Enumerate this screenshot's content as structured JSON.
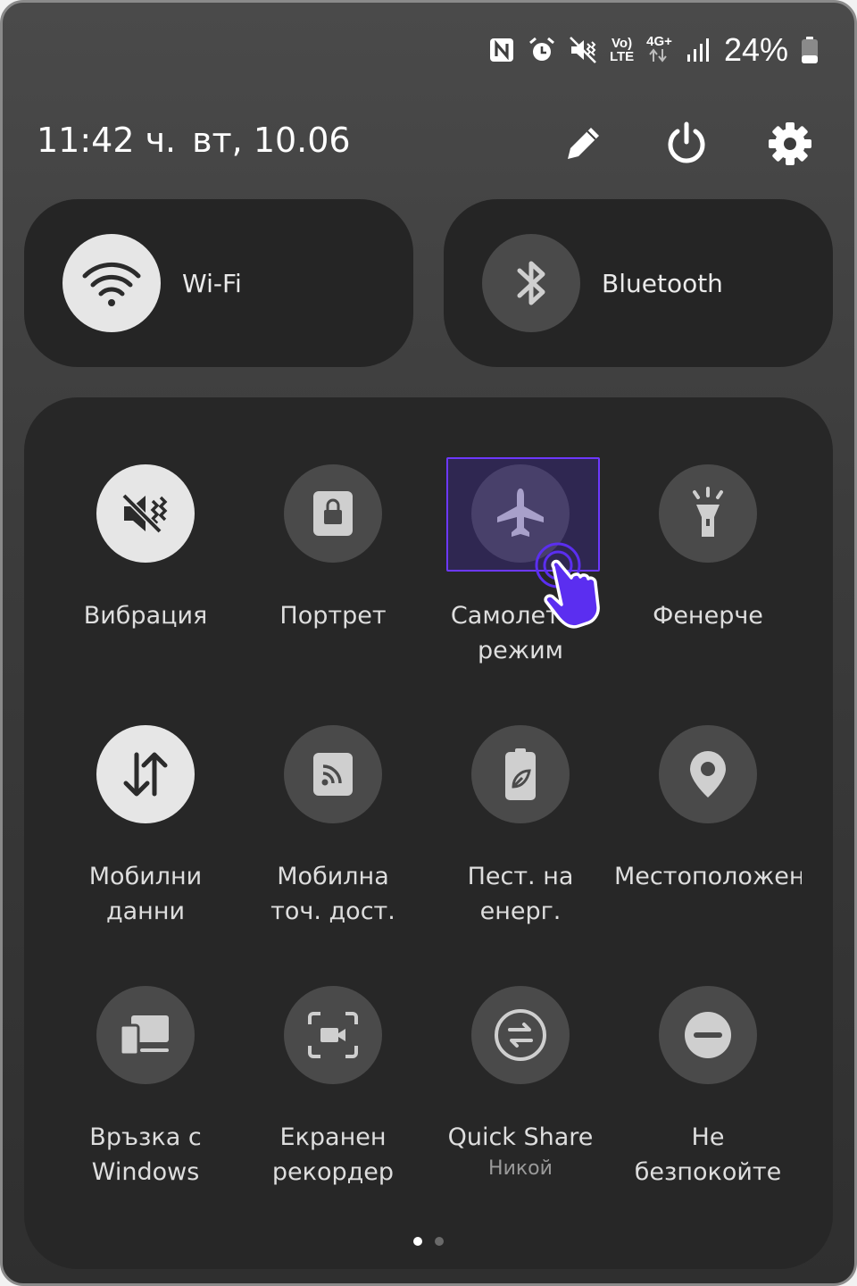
{
  "status_bar": {
    "battery_percent": "24%",
    "volte_top": "Vo)",
    "volte_bottom": "LTE",
    "network_type": "4G+",
    "icons": [
      "nfc-icon",
      "alarm-icon",
      "vibrate-icon",
      "volte-icon",
      "4g-data-icon",
      "signal-icon",
      "battery-icon"
    ]
  },
  "header": {
    "time": "11:42 ч.",
    "date": "вт, 10.06",
    "actions": [
      "edit-icon",
      "power-icon",
      "settings-icon"
    ]
  },
  "big_tiles": [
    {
      "label": "Wi-Fi",
      "icon": "wifi-icon",
      "state": "on"
    },
    {
      "label": "Bluetooth",
      "icon": "bluetooth-icon",
      "state": "off"
    }
  ],
  "tiles": [
    {
      "label": "Вибрация",
      "icon": "vibrate-icon",
      "state": "on"
    },
    {
      "label": "Портрет",
      "icon": "portrait-lock-icon",
      "state": "off"
    },
    {
      "label": "Самолетен\nрежим",
      "icon": "airplane-icon",
      "state": "off"
    },
    {
      "label": "Фенерче",
      "icon": "flashlight-icon",
      "state": "off"
    },
    {
      "label": "Мобилни\nданни",
      "icon": "mobile-data-icon",
      "state": "on"
    },
    {
      "label": "Мобилна\nточ. дост.",
      "icon": "hotspot-icon",
      "state": "off"
    },
    {
      "label": "Пест. на\nенерг.",
      "icon": "power-saving-icon",
      "state": "off"
    },
    {
      "label": "Местоположение",
      "icon": "location-icon",
      "state": "off"
    },
    {
      "label": "Връзка с\nWindows",
      "icon": "link-windows-icon",
      "state": "off"
    },
    {
      "label": "Екранен\nрекордер",
      "icon": "screen-recorder-icon",
      "state": "off"
    },
    {
      "label": "Quick Share",
      "sub": "Никой",
      "icon": "quick-share-icon",
      "state": "off"
    },
    {
      "label": "Не\nбезпокойте",
      "icon": "do-not-disturb-icon",
      "state": "off"
    }
  ],
  "pagination": {
    "pages": 2,
    "current": 1
  },
  "colors": {
    "tile_on": "#e6e6e6",
    "tile_off": "#4a4a4a",
    "highlight": "#6d38ff",
    "cursor": "#5b2ef0"
  }
}
